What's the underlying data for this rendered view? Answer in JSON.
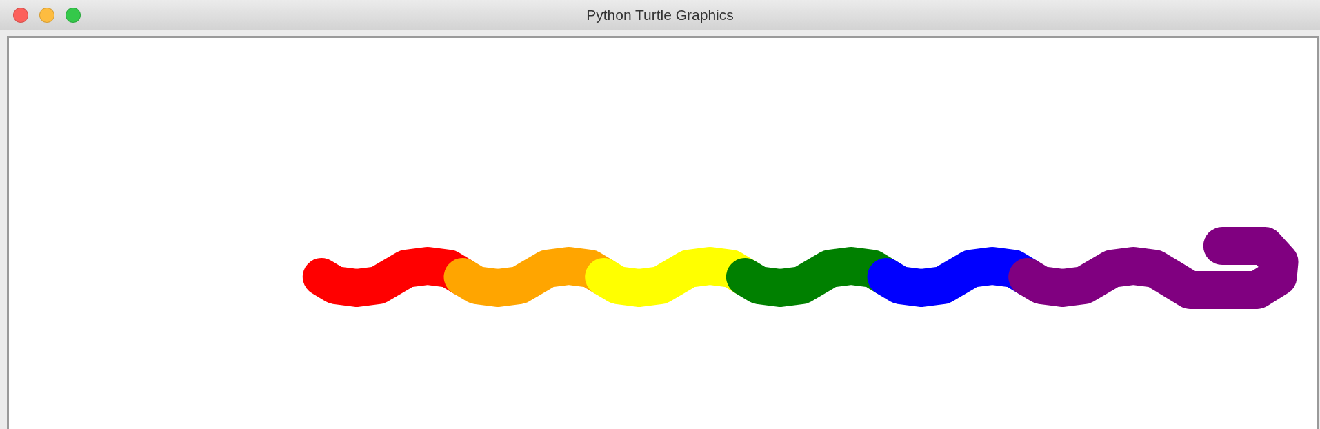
{
  "window": {
    "title": "Python Turtle Graphics"
  },
  "canvas": {
    "snake_segments": [
      {
        "color": "#ff0000"
      },
      {
        "color": "#ffa500"
      },
      {
        "color": "#ffff00"
      },
      {
        "color": "#008000"
      },
      {
        "color": "#0000ff"
      },
      {
        "color": "#800080"
      }
    ]
  }
}
